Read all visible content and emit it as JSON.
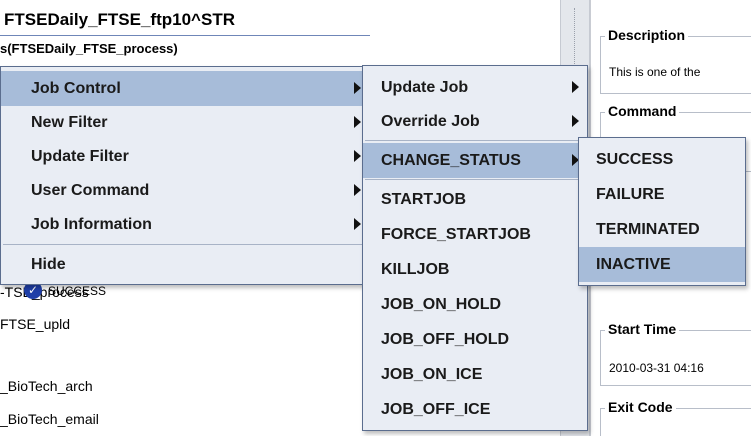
{
  "background": {
    "title": "FTSEDaily_FTSE_ftp10^STR",
    "subtitle": "s(FTSEDaily_FTSE_process)",
    "tree_items": [
      "-TSE_process",
      "FTSE_upld",
      "_BioTech_arch",
      "_BioTech_email"
    ]
  },
  "details": {
    "description_label": "Description",
    "description_text": "This is one of the",
    "command_label": "Command",
    "command_sliver": "0",
    "extra_sliver": "s",
    "status_value": "SUCCESS",
    "start_time_label": "Start Time",
    "start_time_value": "2010-03-31 04:16",
    "exit_code_label": "Exit Code"
  },
  "context_menu": {
    "items": [
      {
        "label": "Job Control",
        "selected": true
      },
      {
        "label": "New Filter",
        "selected": false
      },
      {
        "label": "Update Filter",
        "selected": false
      },
      {
        "label": "User Command",
        "selected": false
      },
      {
        "label": "Job Information",
        "selected": false
      },
      {
        "label": "Hide",
        "selected": false
      }
    ]
  },
  "job_control_menu": {
    "items": [
      {
        "label": "Update Job"
      },
      {
        "label": "Override Job"
      },
      {
        "label": "CHANGE_STATUS"
      },
      {
        "label": "STARTJOB"
      },
      {
        "label": "FORCE_STARTJOB"
      },
      {
        "label": "KILLJOB"
      },
      {
        "label": "JOB_ON_HOLD"
      },
      {
        "label": "JOB_OFF_HOLD"
      },
      {
        "label": "JOB_ON_ICE"
      },
      {
        "label": "JOB_OFF_ICE"
      }
    ]
  },
  "change_status_menu": {
    "items": [
      {
        "label": "SUCCESS"
      },
      {
        "label": "FAILURE"
      },
      {
        "label": "TERMINATED"
      },
      {
        "label": "INACTIVE"
      }
    ]
  },
  "colors": {
    "menu_bg": "#e9edf4",
    "highlight": "#a7bcd9",
    "status_icon": "#1f3fa8"
  },
  "icons": {
    "submenu_arrow": "arrow-right-icon",
    "status_check": "check-circle-icon"
  }
}
